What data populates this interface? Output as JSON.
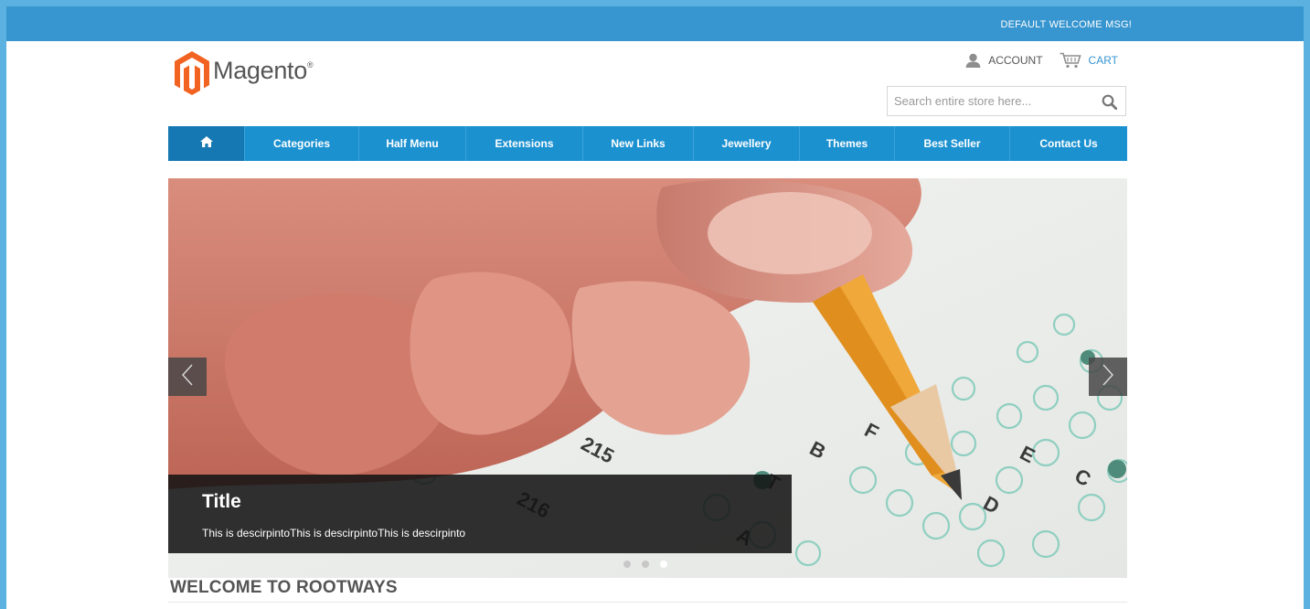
{
  "header": {
    "welcome_msg": "DEFAULT WELCOME MSG!",
    "logo_text": "Magento",
    "logo_mark": "®",
    "account_label": "ACCOUNT",
    "cart_label": "CART",
    "search_placeholder": "Search entire store here..."
  },
  "nav": {
    "items": [
      {
        "label": "Categories"
      },
      {
        "label": "Half Menu"
      },
      {
        "label": "Extensions"
      },
      {
        "label": "New Links"
      },
      {
        "label": "Jewellery"
      },
      {
        "label": "Themes"
      },
      {
        "label": "Best Seller"
      },
      {
        "label": "Contact Us"
      }
    ]
  },
  "slider": {
    "title": "Title",
    "description": "This is descirpintoThis is descirpintoThis is descirpinto",
    "slide_count": 3,
    "active_slide": 3,
    "image_text": [
      "215",
      "216",
      "A",
      "B",
      "C",
      "D",
      "E",
      "T",
      "F"
    ]
  },
  "main": {
    "heading": "WELCOME TO ROOTWAYS"
  },
  "colors": {
    "topbar": "#3795cf",
    "nav": "#1c91d0",
    "nav_home": "#1578b3",
    "logo_orange": "#f26322"
  }
}
